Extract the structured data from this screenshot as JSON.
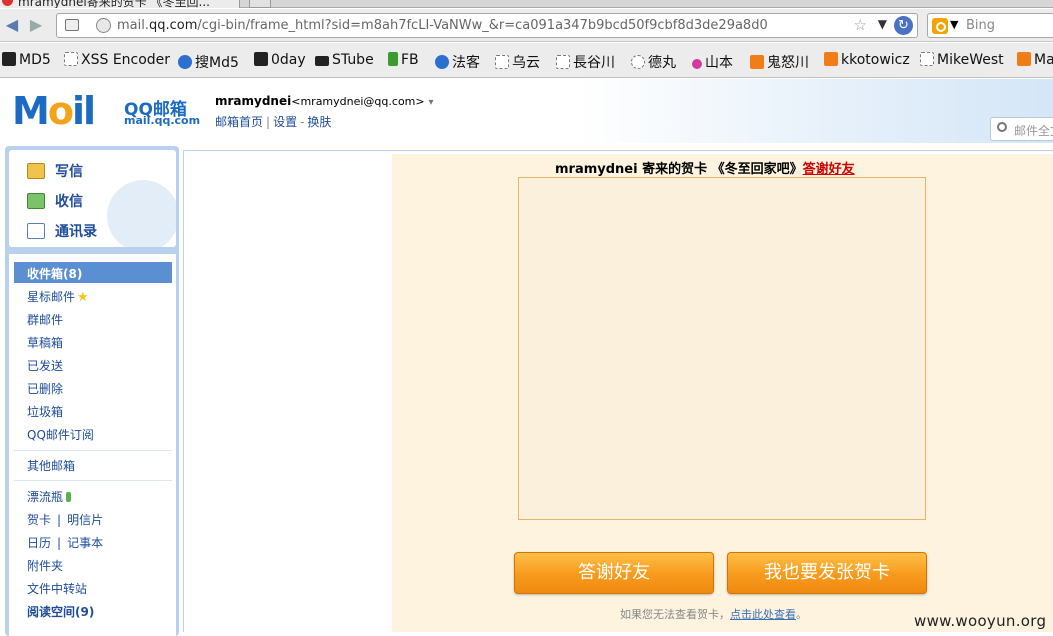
{
  "browser": {
    "tab_title": "mramydnei寄来的贺卡 《冬至回...",
    "url_prefix": "mail.",
    "url_domain": "qq.com",
    "url_path": "/cgi-bin/frame_html?sid=m8ah7fcLI-VaNWw_&r=ca091a347b9bcd50f9cbf8d3de29a8d0",
    "search_placeholder": "Bing",
    "bookmarks": [
      "MD5",
      "XSS Encoder",
      "搜Md5",
      "0day",
      "STube",
      "FB",
      "法客",
      "乌云",
      "長谷川",
      "德丸",
      "山本",
      "鬼怒川",
      "kkotowicz",
      "MikeWest",
      "Ma"
    ]
  },
  "header": {
    "logo_m": "M",
    "logo_o": "o",
    "logo_il": "il",
    "logo_name": "QQ邮箱",
    "logo_domain": "mail.qq.com",
    "user_name": "mramydnei",
    "user_email": "<mramydnei@qq.com>",
    "caret": "▾",
    "link_home": "邮箱首页",
    "link_settings": "设置",
    "link_skin": "换肤",
    "search_placeholder": "邮件全文"
  },
  "sidebar": {
    "compose": "写信",
    "receive": "收信",
    "contacts": "通讯录",
    "inbox": "收件箱(8)",
    "starred": "星标邮件",
    "group": "群邮件",
    "drafts": "草稿箱",
    "sent": "已发送",
    "deleted": "已删除",
    "trash": "垃圾箱",
    "subscription": "QQ邮件订阅",
    "other_mailbox": "其他邮箱",
    "drift_bottle": "漂流瓶",
    "greeting_card": "贺卡",
    "postcard": "明信片",
    "calendar": "日历",
    "notepad": "记事本",
    "attachments": "附件夹",
    "file_transfer": "文件中转站",
    "reading_space": "阅读空间(9)"
  },
  "card": {
    "title": "mramydnei 寄来的贺卡 《冬至回家吧》",
    "thank_link": "答谢好友",
    "btn_thank": "答谢好友",
    "btn_send": "我也要发张贺卡",
    "cant_view_prefix": "如果您无法查看贺卡，",
    "cant_view_link": "点击此处查看",
    "cant_view_suffix": "。"
  },
  "watermark": "www.wooyun.org",
  "colors": {
    "brand_blue": "#1c6bc3",
    "link_blue": "#1f4c9a",
    "button_orange": "#f79a1c",
    "card_bg": "#fdf3de",
    "thank_red": "#cc0000"
  }
}
